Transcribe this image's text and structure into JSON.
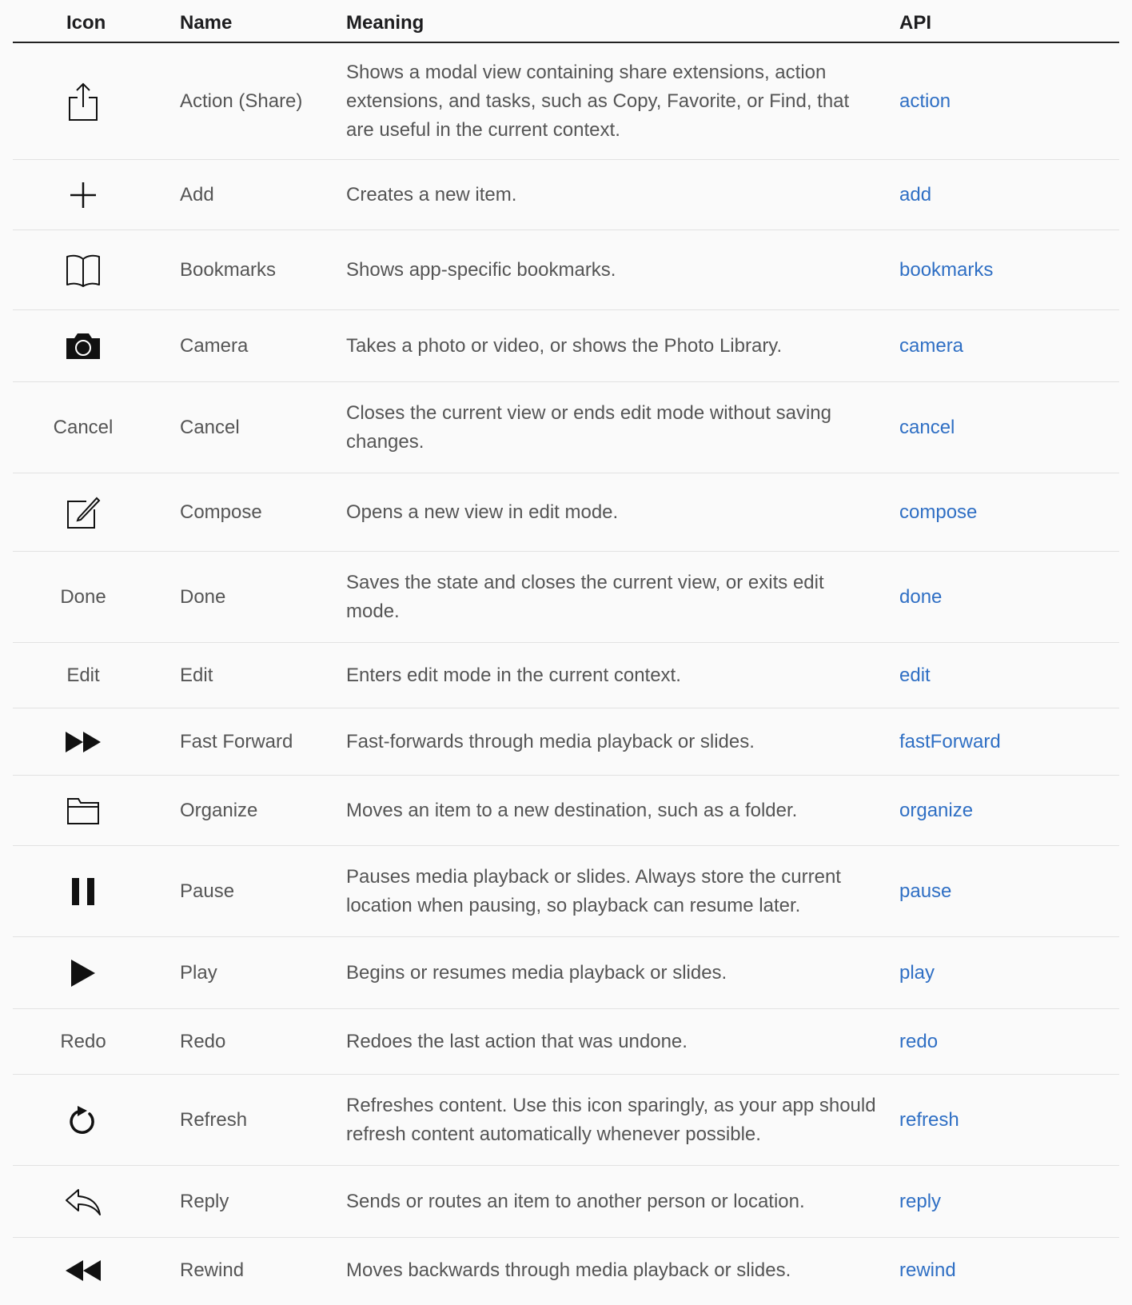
{
  "header": {
    "icon": "Icon",
    "name": "Name",
    "meaning": "Meaning",
    "api": "API"
  },
  "rows": [
    {
      "icon": "share-icon",
      "name": "Action (Share)",
      "meaning": "Shows a modal view containing share extensions, action extensions, and tasks, such as Copy, Favorite, or Find, that are useful in the current context.",
      "api": "action"
    },
    {
      "icon": "plus-icon",
      "name": "Add",
      "meaning": "Creates a new item.",
      "api": "add"
    },
    {
      "icon": "book-icon",
      "name": "Bookmarks",
      "meaning": "Shows app-specific bookmarks.",
      "api": "bookmarks"
    },
    {
      "icon": "camera-icon",
      "name": "Camera",
      "meaning": "Takes a photo or video, or shows the Photo Library.",
      "api": "camera"
    },
    {
      "icon_text": "Cancel",
      "name": "Cancel",
      "meaning": "Closes the current view or ends edit mode without saving changes.",
      "api": "cancel"
    },
    {
      "icon": "compose-icon",
      "name": "Compose",
      "meaning": "Opens a new view in edit mode.",
      "api": "compose"
    },
    {
      "icon_text": "Done",
      "name": "Done",
      "meaning": "Saves the state and closes the current view, or exits edit mode.",
      "api": "done"
    },
    {
      "icon_text": "Edit",
      "name": "Edit",
      "meaning": "Enters edit mode in the current context.",
      "api": "edit"
    },
    {
      "icon": "fast-forward-icon",
      "name": "Fast Forward",
      "meaning": "Fast-forwards through media playback or slides.",
      "api": "fastForward"
    },
    {
      "icon": "folder-icon",
      "name": "Organize",
      "meaning": "Moves an item to a new destination, such as a folder.",
      "api": "organize"
    },
    {
      "icon": "pause-icon",
      "name": "Pause",
      "meaning": "Pauses media playback or slides. Always store the current location when pausing, so playback can resume later.",
      "api": "pause"
    },
    {
      "icon": "play-icon",
      "name": "Play",
      "meaning": "Begins or resumes media playback or slides.",
      "api": "play"
    },
    {
      "icon_text": "Redo",
      "name": "Redo",
      "meaning": "Redoes the last action that was undone.",
      "api": "redo"
    },
    {
      "icon": "refresh-icon",
      "name": "Refresh",
      "meaning": "Refreshes content. Use this icon sparingly, as your app should refresh content automatically whenever possible.",
      "api": "refresh"
    },
    {
      "icon": "reply-icon",
      "name": "Reply",
      "meaning": "Sends or routes an item to another person or location.",
      "api": "reply"
    },
    {
      "icon": "rewind-icon",
      "name": "Rewind",
      "meaning": "Moves backwards through media playback or slides.",
      "api": "rewind"
    }
  ]
}
